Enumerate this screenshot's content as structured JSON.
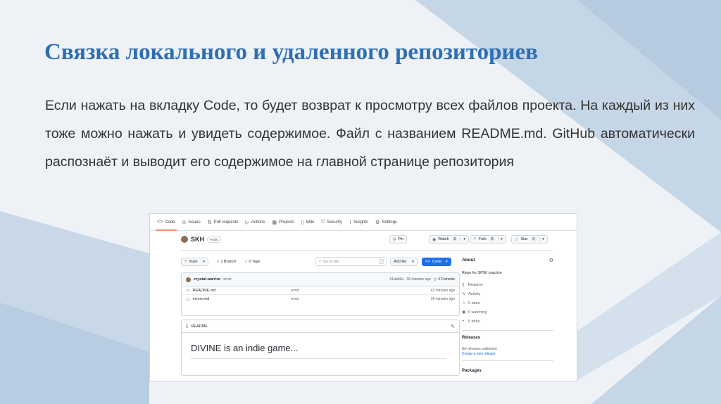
{
  "slide": {
    "title": "Связка локального и удаленного репозиториев",
    "body": "Если нажать на вкладку Code, то будет возврат к просмотру всех файлов проекта. На каждый из них тоже можно нажать и увидеть содержимое. Файл с названием README.md. GitHub автоматически распознаёт и выводит его содержимое на главной странице репозитория"
  },
  "github": {
    "tabs": [
      {
        "label": "Code",
        "icon": "code-icon"
      },
      {
        "label": "Issues",
        "icon": "issue-icon"
      },
      {
        "label": "Pull requests",
        "icon": "pull-request-icon"
      },
      {
        "label": "Actions",
        "icon": "play-icon"
      },
      {
        "label": "Projects",
        "icon": "table-icon"
      },
      {
        "label": "Wiki",
        "icon": "book-icon"
      },
      {
        "label": "Security",
        "icon": "shield-icon"
      },
      {
        "label": "Insights",
        "icon": "graph-icon"
      },
      {
        "label": "Settings",
        "icon": "gear-icon"
      }
    ],
    "repo": {
      "name": "SKH",
      "visibility": "Public"
    },
    "actions": {
      "pin": "Pin",
      "watch": "Watch",
      "watch_count": "0",
      "fork": "Fork",
      "fork_count": "0",
      "star": "Star",
      "star_count": "0"
    },
    "branch": {
      "current": "main",
      "branches_label": "1 Branch",
      "tags_label": "0 Tags"
    },
    "search": {
      "placeholder": "Go to file",
      "shortcut": "t"
    },
    "add_file_label": "Add file",
    "code_label": "Code",
    "commit": {
      "author": "crystal-warrior",
      "message": "error",
      "hash_time": "01abd9a · 36 minutes ago",
      "commits_label": "4 Commits"
    },
    "files": [
      {
        "name": "README.md",
        "message": "error",
        "time": "42 minutes ago"
      },
      {
        "name": "errors.md",
        "message": "error",
        "time": "36 minutes ago"
      }
    ],
    "readme": {
      "header": "README",
      "heading": "DIVINE is an indie game..."
    },
    "about": {
      "title": "About",
      "description": "Repo for SP56 practice",
      "items": [
        {
          "label": "Readme",
          "icon": "book-icon"
        },
        {
          "label": "Activity",
          "icon": "pulse-icon"
        },
        {
          "label": "0 stars",
          "icon": "star-icon"
        },
        {
          "label": "0 watching",
          "icon": "eye-icon"
        },
        {
          "label": "0 forks",
          "icon": "fork-icon"
        }
      ]
    },
    "releases": {
      "title": "Releases",
      "none": "No releases published",
      "create_link": "Create a new release"
    },
    "packages": {
      "title": "Packages"
    }
  }
}
